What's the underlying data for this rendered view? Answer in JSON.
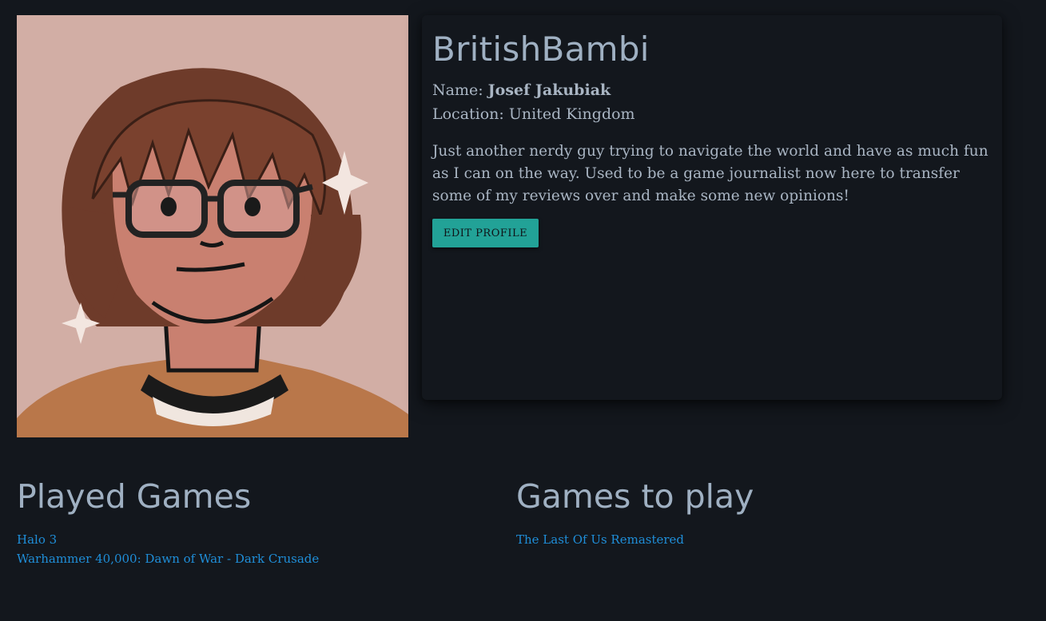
{
  "profile": {
    "username": "BritishBambi",
    "name_label": "Name:",
    "name_value": "Josef Jakubiak",
    "location_label": "Location:",
    "location_value": "United Kingdom",
    "bio": "Just another nerdy guy trying to navigate the world and have as much fun as I can on the way. Used to be a game journalist now here to transfer some of my reviews over and make some new opinions!",
    "edit_button": "EDIT PROFILE"
  },
  "played_games": {
    "title": "Played Games",
    "items": [
      "Halo 3",
      "Warhammer 40,000: Dawn of War - Dark Crusade"
    ]
  },
  "games_to_play": {
    "title": "Games to play",
    "items": [
      "The Last Of Us Remastered"
    ]
  },
  "colors": {
    "background": "#13171d",
    "accent_button": "#22a297",
    "link": "#1f8ed8",
    "heading": "#9fb0c2"
  }
}
